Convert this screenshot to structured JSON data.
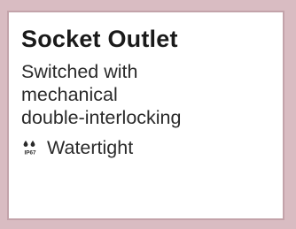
{
  "card": {
    "title": "Socket Outlet",
    "description_lines": [
      "Switched with",
      "mechanical",
      "double-interlocking"
    ],
    "feature": {
      "icon": "ip67-water-drops-icon",
      "icon_text": "IP67",
      "label": "Watertight"
    }
  },
  "colors": {
    "background": "#d9bcc2",
    "card_border": "#c3a3aa",
    "card_background": "#ffffff",
    "text": "#1f1f1f"
  }
}
